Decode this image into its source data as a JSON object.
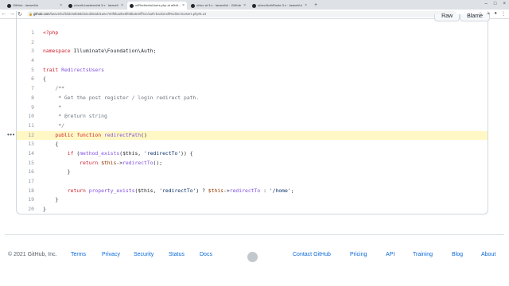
{
  "browser": {
    "tabs": [
      {
        "label": "GitHub - laravel/ui",
        "active": false
      },
      {
        "label": "ui/auth-backend/at 3.x · laravel/",
        "active": false
      },
      {
        "label": "ui/RedirectsUsers.php at a0b8...",
        "active": true
      },
      {
        "label": "ui/src at 3.x · laravel/ui · GitHub",
        "active": false
      },
      {
        "label": "ui/src/AuthRoute 3.x · laravel/ui",
        "active": false
      }
    ],
    "new_tab": "+",
    "url_domain": "github.com",
    "url_path": "/laravel/ui/blob/a0b8dd42ed352dd1a6c700f0ba2be6f09ba6c0ff/src/auth-backend/RedirectsUsers.php#L13"
  },
  "file_actions": {
    "raw": "Raw",
    "blame": "Blame"
  },
  "code_lines": [
    {
      "num": "1"
    },
    {
      "num": "2"
    },
    {
      "num": "3"
    },
    {
      "num": "4"
    },
    {
      "num": "5"
    },
    {
      "num": "6"
    },
    {
      "num": "7"
    },
    {
      "num": "8"
    },
    {
      "num": "9"
    },
    {
      "num": "10"
    },
    {
      "num": "11"
    },
    {
      "num": "12"
    },
    {
      "num": "13"
    },
    {
      "num": "14"
    },
    {
      "num": "15"
    },
    {
      "num": "16"
    },
    {
      "num": "17"
    },
    {
      "num": "18"
    },
    {
      "num": "19"
    },
    {
      "num": "20"
    }
  ],
  "code": {
    "l1": "<?php",
    "l3_kw": "namespace",
    "l3_ns": " Illuminate\\Foundation\\Auth;",
    "l5_kw": "trait",
    "l5_name": " RedirectsUsers",
    "l6": "{",
    "l7": "    /**",
    "l8": "     * Get the post register / login redirect path.",
    "l9": "     *",
    "l10": "     * @return string",
    "l11": "     */",
    "l12_kw": "    public function",
    "l12_fn": " redirectPath",
    "l12_rest": "()",
    "l13": "    {",
    "l14_kw": "        if",
    "l14_a": " (",
    "l14_fn": "method_exists",
    "l14_b": "($this, ",
    "l14_str": "'redirectTo'",
    "l14_c": ")) {",
    "l15_kw": "            return",
    "l15_var": " $this",
    "l15_a": "->",
    "l15_fn": "redirectTo",
    "l15_b": "();",
    "l16": "        }",
    "l18_kw": "        return",
    "l18_fn": " property_exists",
    "l18_a": "($this, ",
    "l18_str": "'redirectTo'",
    "l18_b": ") ? ",
    "l18_var": "$this",
    "l18_c": "->",
    "l18_fn2": "redirectTo",
    "l18_d": " : ",
    "l18_str2": "'/home'",
    "l18_e": ";",
    "l19": "    }",
    "l20": "}"
  },
  "footer": {
    "copyright": "© 2021 GitHub, Inc.",
    "links_left": [
      "Terms",
      "Privacy",
      "Security",
      "Status",
      "Docs"
    ],
    "links_right": [
      "Contact GitHub",
      "Pricing",
      "API",
      "Training",
      "Blog",
      "About"
    ]
  },
  "colors": {
    "link": "#0969da",
    "highlight": "#fff8c5",
    "keyword": "#cf222e",
    "function": "#8250df",
    "string": "#0a3069"
  },
  "icons": [
    "github-favicon",
    "back-icon",
    "forward-icon",
    "reload-icon",
    "lock-icon",
    "star-icon",
    "extensions-icon",
    "profile-icon",
    "menu-icon",
    "kebab-icon",
    "octocat-icon"
  ]
}
